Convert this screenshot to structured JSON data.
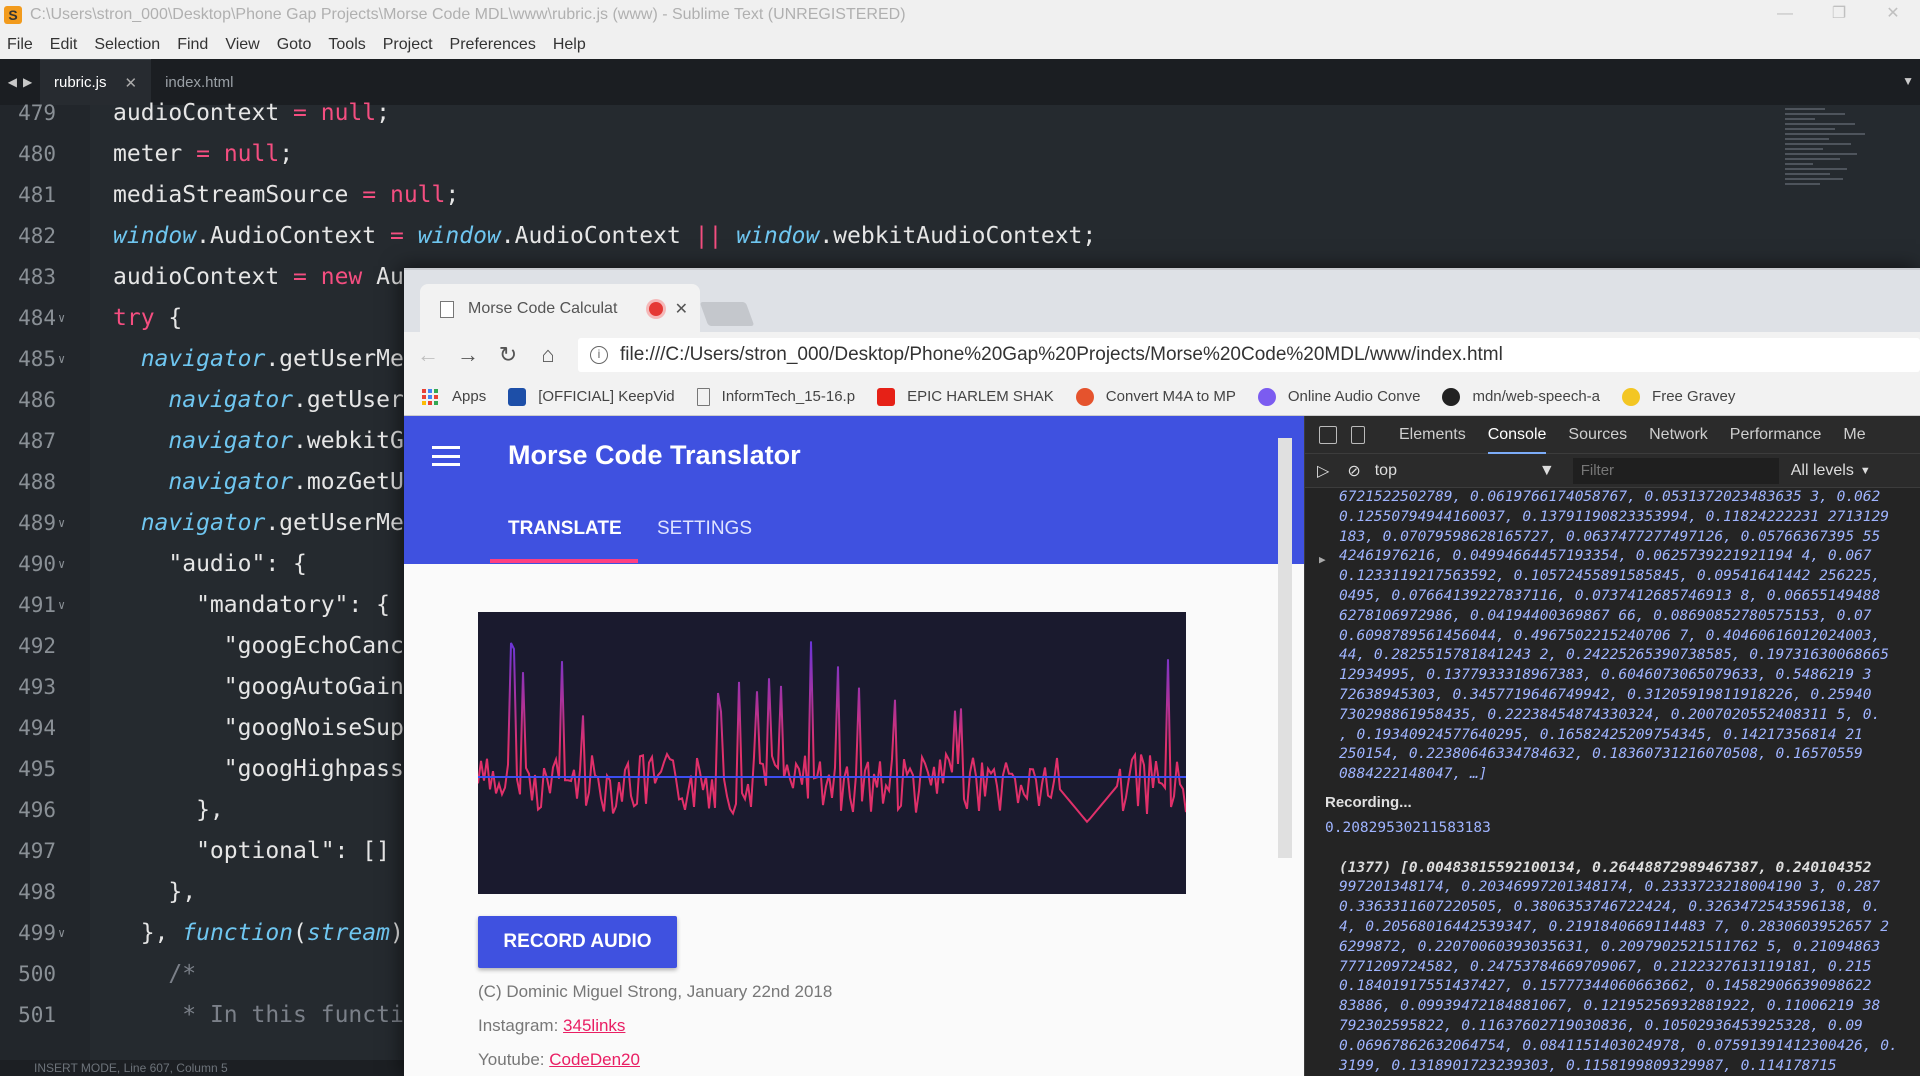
{
  "window": {
    "title": "C:\\Users\\stron_000\\Desktop\\Phone Gap Projects\\Morse Code MDL\\www\\rubric.js (www) - Sublime Text (UNREGISTERED)",
    "controls": [
      "—",
      "❐",
      "✕"
    ]
  },
  "menu": [
    "File",
    "Edit",
    "Selection",
    "Find",
    "View",
    "Goto",
    "Tools",
    "Project",
    "Preferences",
    "Help"
  ],
  "editor_tabs": [
    {
      "label": "rubric.js",
      "active": true
    },
    {
      "label": "index.html",
      "active": false
    }
  ],
  "code_lines": [
    {
      "n": "479",
      "fold": "",
      "html": "audioContext <span class=kw>=</span> <span class=kw>null</span>;"
    },
    {
      "n": "480",
      "fold": "",
      "html": "meter <span class=kw>=</span> <span class=kw>null</span>;"
    },
    {
      "n": "481",
      "fold": "",
      "html": "mediaStreamSource <span class=kw>=</span> <span class=kw>null</span>;"
    },
    {
      "n": "482",
      "fold": "",
      "html": "<span class=it>window</span>.AudioContext <span class=kw>=</span> <span class=it>window</span>.AudioContext <span class=kw>||</span> <span class=it>window</span>.webkitAudioContext;"
    },
    {
      "n": "483",
      "fold": "",
      "html": "audioContext <span class=kw>=</span> <span class=kw>new</span> Au"
    },
    {
      "n": "484",
      "fold": "∨",
      "html": "<span class=kw>try</span> {"
    },
    {
      "n": "485",
      "fold": "∨",
      "html": "  <span class=it>navigator</span>.getUserMe"
    },
    {
      "n": "486",
      "fold": "",
      "html": "    <span class=it>navigator</span>.getUser"
    },
    {
      "n": "487",
      "fold": "",
      "html": "    <span class=it>navigator</span>.webkitG"
    },
    {
      "n": "488",
      "fold": "",
      "html": "    <span class=it>navigator</span>.mozGetU"
    },
    {
      "n": "489",
      "fold": "∨",
      "html": "  <span class=it>navigator</span>.getUserMe"
    },
    {
      "n": "490",
      "fold": "∨",
      "html": "    \"audio\": {"
    },
    {
      "n": "491",
      "fold": "∨",
      "html": "      \"mandatory\": {"
    },
    {
      "n": "492",
      "fold": "",
      "html": "        \"googEchoCanc"
    },
    {
      "n": "493",
      "fold": "",
      "html": "        \"googAutoGain"
    },
    {
      "n": "494",
      "fold": "",
      "html": "        \"googNoiseSup"
    },
    {
      "n": "495",
      "fold": "",
      "html": "        \"googHighpass"
    },
    {
      "n": "496",
      "fold": "",
      "html": "      },"
    },
    {
      "n": "497",
      "fold": "",
      "html": "      \"optional\": []"
    },
    {
      "n": "498",
      "fold": "",
      "html": "    },"
    },
    {
      "n": "499",
      "fold": "∨",
      "html": "  }, <span class=it>function</span>(<span class=it>stream</span>)"
    },
    {
      "n": "500",
      "fold": "",
      "html": "    <span class=cm>/*</span>"
    },
    {
      "n": "501",
      "fold": "",
      "html": "     <span class=cm>* In this functi</span>"
    }
  ],
  "status": "INSERT MODE, Line 607, Column 5",
  "browser": {
    "tab_title": "Morse Code Calculat",
    "url": "file:///C:/Users/stron_000/Desktop/Phone%20Gap%20Projects/Morse%20Code%20MDL/www/index.html",
    "bookmarks": [
      {
        "label": "Apps",
        "icon": "apps-grid-icon",
        "color": ""
      },
      {
        "label": "[OFFICIAL] KeepVid",
        "icon": "keepvid-icon",
        "color": "#1d4fa8"
      },
      {
        "label": "InformTech_15-16.p",
        "icon": "document-icon",
        "color": ""
      },
      {
        "label": "EPIC HARLEM SHAK",
        "icon": "youtube-icon",
        "color": "#e62117"
      },
      {
        "label": "Convert M4A to MP",
        "icon": "convert-icon",
        "color": "#e5532d"
      },
      {
        "label": "Online Audio Conve",
        "icon": "audio-converter-icon",
        "color": "#7b5cf0"
      },
      {
        "label": "mdn/web-speech-a",
        "icon": "github-icon",
        "color": "#222"
      },
      {
        "label": "Free Gravey",
        "icon": "smiley-icon",
        "color": "#f3c623"
      }
    ]
  },
  "app": {
    "title": "Morse Code Translator",
    "tabs": [
      "TRANSLATE",
      "SETTINGS"
    ],
    "record_button": "RECORD AUDIO",
    "copyright": "(C) Dominic Miguel Strong, January 22nd 2018",
    "instagram_label": "Instagram:",
    "instagram_link": "345links",
    "youtube_label": "Youtube:",
    "youtube_link": "CodeDen20",
    "waveform_colors": [
      "#e0306a",
      "#6a35d8"
    ],
    "baseline_color": "#3b4ef0"
  },
  "devtools": {
    "tabs": [
      "Elements",
      "Console",
      "Sources",
      "Network",
      "Performance",
      "Me"
    ],
    "active_tab": "Console",
    "context": "top",
    "filter_placeholder": "Filter",
    "levels": "All levels",
    "lines_a": [
      "6721522502789, 0.0619766174058767, 0.0531372023483635 3, 0.062",
      "0.12550794944160037, 0.13791190823353994, 0.11824222231 2713129",
      "183, 0.07079598628165727, 0.0637477277497126, 0.05766367395 55",
      "42461976216, 0.04994664457193354, 0.0625739221921194 4, 0.067",
      "0.1233119217563592, 0.10572455891585845, 0.09541641442 256225,",
      "0495, 0.07664139227837116, 0.0737412685746913 8, 0.06655149488",
      "6278106972986, 0.04194400369867 66, 0.08690852780575153, 0.07",
      "0.6098789561456044, 0.4967502215240706 7, 0.40460616012024003,",
      "44, 0.2825515781841243 2, 0.24225265390738585, 0.19731630068665",
      "12934995, 0.1377933318967383, 0.6046073065079633, 0.5486219 3",
      "72638945303, 0.3457719646749942, 0.31205919811918226, 0.25940",
      "730298861958435, 0.22238454874330324, 0.2007020552408311 5, 0.",
      ", 0.19340924577640295, 0.16582425209754345, 0.14217356814 21",
      "250154, 0.22380646334784632, 0.18360731216070508, 0.16570559",
      "0884222148047, …]"
    ],
    "log_text": "Recording...",
    "log_value": "0.20829530211583183",
    "lines_b": [
      "(1377) [0.00483815592100134, 0.26448872989467387, 0.240104352",
      "997201348174, 0.20346997201348174, 0.2333723218004190 3, 0.287",
      "0.3363311607220505, 0.3806353746722424, 0.3263472543596138, 0.",
      "4, 0.20568016442539347, 0.2191840669114483 7, 0.2830603952657 2",
      "6299872, 0.22070060393035631, 0.2097902521511762 5, 0.21094863",
      "7771209724582, 0.24753784669709067, 0.2122327613119181, 0.215",
      "0.18401917551437427, 0.15777344060663662, 0.14582906639098622",
      "83886, 0.09939472184881067, 0.12195256932881922, 0.11006219 38",
      "792302595822, 0.11637602719030836, 0.10502936453925328, 0.09",
      "0.06967862632064754, 0.0841151403024978, 0.07591391412300426, 0.",
      "3199, 0.1318901723239303, 0.1158199809329987, 0.114178715"
    ]
  }
}
